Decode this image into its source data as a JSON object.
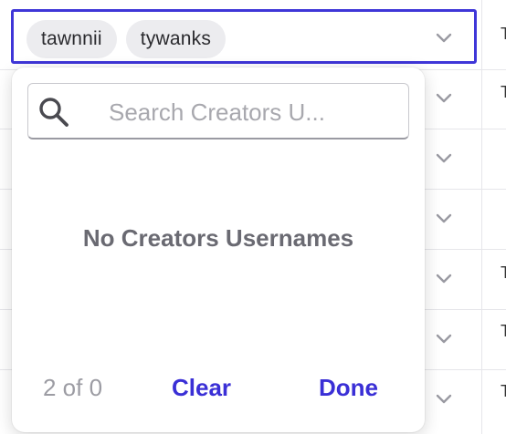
{
  "cell": {
    "selected_chips": [
      {
        "label": "tawnnii"
      },
      {
        "label": "tywanks"
      }
    ],
    "chevron_icon": "chevron-down-icon"
  },
  "dropdown": {
    "search": {
      "placeholder": "Search Creators U...",
      "value": "",
      "icon": "search-icon"
    },
    "empty_message": "No Creators Usernames",
    "footer": {
      "count_text": "2 of 0",
      "clear_label": "Clear",
      "done_label": "Done"
    }
  },
  "colors": {
    "accent": "#3a2fd6",
    "focus_border": "#3f36d8",
    "chip_bg": "#ececef",
    "muted_text": "#9c9ca3"
  }
}
